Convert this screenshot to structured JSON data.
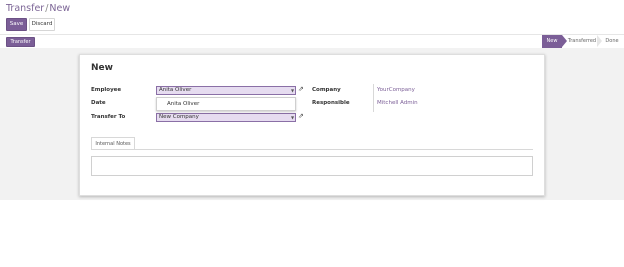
{
  "breadcrumb": {
    "parent": "Transfer",
    "separator": "/",
    "current": "New"
  },
  "toolbar": {
    "save_label": "Save",
    "discard_label": "Discard"
  },
  "header": {
    "transfer_button_label": "Transfer"
  },
  "statusbar": {
    "steps": [
      "New",
      "Transferred",
      "Done"
    ],
    "active": "New"
  },
  "form": {
    "title": "New",
    "employee_label": "Employee",
    "employee_value": "Anita Oliver",
    "date_label": "Date",
    "transfer_to_label": "Transfer To",
    "transfer_to_value": "New Company",
    "company_label": "Company",
    "company_value": "YourCompany",
    "responsible_label": "Responsible",
    "responsible_value": "Mitchell Admin"
  },
  "autocomplete": {
    "options": [
      "Anita Oliver"
    ]
  },
  "notebook": {
    "tabs": [
      "Internal Notes"
    ]
  },
  "colors": {
    "accent": "#7b5e97",
    "field_bg": "#e6dcf0",
    "sheet_bg": "#f2f2f2"
  }
}
